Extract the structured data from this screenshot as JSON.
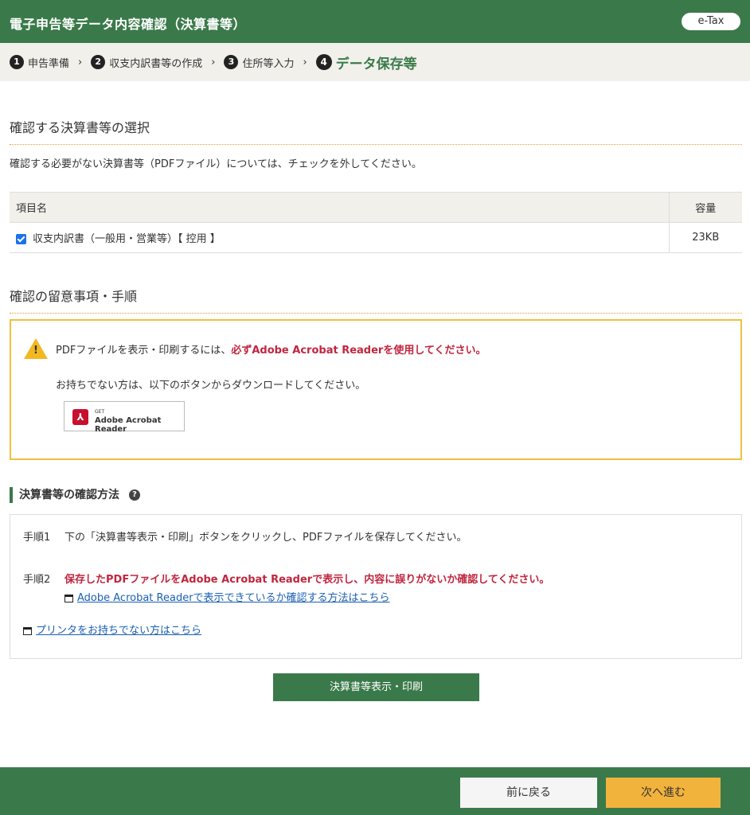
{
  "header": {
    "title": "電子申告等データ内容確認（決算書等）",
    "badge": "e-Tax"
  },
  "steps": [
    {
      "num": "1",
      "label": "申告準備"
    },
    {
      "num": "2",
      "label": "収支内訳書等の作成"
    },
    {
      "num": "3",
      "label": "住所等入力"
    },
    {
      "num": "4",
      "label": "データ保存等"
    }
  ],
  "step_separator": "›",
  "selection": {
    "title": "確認する決算書等の選択",
    "description": "確認する必要がない決算書等（PDFファイル）については、チェックを外してください。",
    "table": {
      "headers": [
        "項目名",
        "容量"
      ],
      "rows": [
        {
          "checked": true,
          "name": "収支内訳書（一般用・営業等）【 控用 】",
          "size": "23KB"
        }
      ]
    }
  },
  "notes": {
    "title": "確認の留意事項・手順",
    "warning_symbol": "!",
    "line1_prefix": "PDFファイルを表示・印刷するには、",
    "line1_emphasis": "必ずAdobe Acrobat Readerを使用してください。",
    "line2": "お持ちでない方は、以下のボタンからダウンロードしてください。",
    "adobe_button": {
      "get": "GET",
      "name": "Adobe Acrobat Reader"
    }
  },
  "method": {
    "title": "決算書等の確認方法",
    "help_symbol": "?",
    "step1_label": "手順1",
    "step1_text": "下の「決算書等表示・印刷」ボタンをクリックし、PDFファイルを保存してください。",
    "step2_label": "手順2",
    "step2_text": "保存したPDFファイルをAdobe Acrobat Readerで表示し、内容に誤りがないか確認してください。",
    "step2_link": "Adobe Acrobat Readerで表示できているか確認する方法はこちら",
    "printer_link": "プリンタをお持ちでない方はこちら"
  },
  "print_button": "決算書等表示・印刷",
  "footer": {
    "back_label": "前に戻る",
    "next_label": "次へ進む"
  },
  "colors": {
    "brand_green": "#3a7a4a",
    "accent_yellow": "#f2b33d",
    "emphasis_red": "#c0263e",
    "link_blue": "#1a5fb4"
  }
}
